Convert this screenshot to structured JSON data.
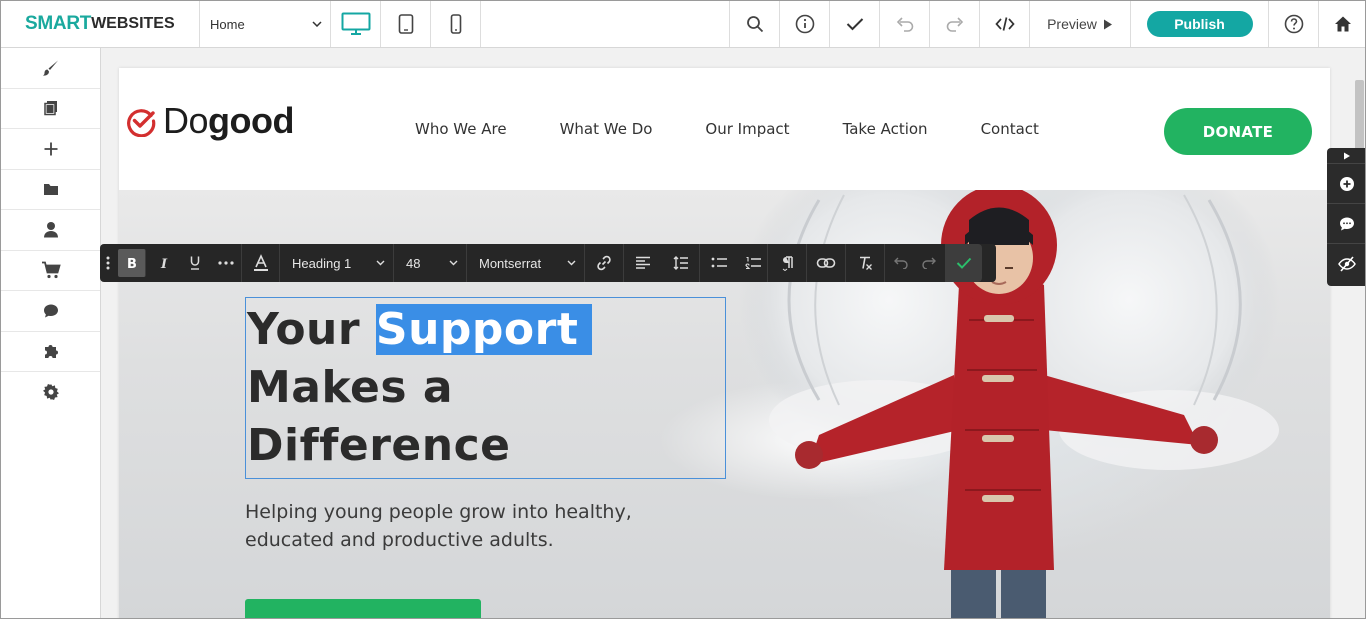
{
  "app": {
    "brand_first": "SMART",
    "brand_second": "WEBSITES",
    "page_select": "Home"
  },
  "toolbar": {
    "preview_label": "Preview",
    "publish_label": "Publish"
  },
  "site": {
    "logo_light": "Do",
    "logo_bold": "good",
    "nav": [
      "Who We Are",
      "What We Do",
      "Our Impact",
      "Take Action",
      "Contact"
    ],
    "donate_label": "DONATE",
    "hero": {
      "heading_line1_a": "Your ",
      "heading_line1_b": "Support",
      "heading_line2": "Makes a",
      "heading_line3": "Difference",
      "subtext": "Helping young people grow into healthy, educated and productive adults."
    }
  },
  "editor_toolbar": {
    "block_style": "Heading 1",
    "font_size": "48",
    "font_family": "Montserrat"
  },
  "colors": {
    "brand_teal": "#1aa99e",
    "publish": "#14a7a3",
    "donate_green": "#22b361",
    "selection_blue": "#3a8ee6",
    "logo_check_red": "#d32f2f"
  }
}
